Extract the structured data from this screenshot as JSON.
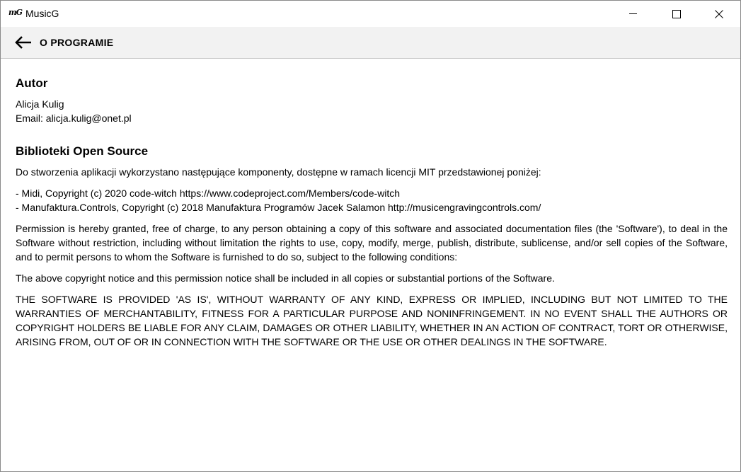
{
  "window": {
    "logo_text": "mG",
    "title": "MusicG"
  },
  "header": {
    "title": "O PROGRAMIE"
  },
  "author": {
    "heading": "Autor",
    "name": "Alicja Kulig",
    "email_line": "Email: alicja.kulig@onet.pl"
  },
  "open_source": {
    "heading": "Biblioteki Open Source",
    "intro": "Do stworzenia aplikacji wykorzystano następujące komponenty, dostępne w ramach licencji MIT przedstawionej poniżej:",
    "libraries": [
      "- Midi, Copyright (c) 2020 code-witch https://www.codeproject.com/Members/code-witch",
      "- Manufaktura.Controls, Copyright (c) 2018 Manufaktura Programów Jacek Salamon http://musicengravingcontrols.com/"
    ],
    "permission": "Permission is hereby granted, free of charge, to any person obtaining a copy of this software and associated documentation files (the 'Software'), to deal in the Software without restriction, including without limitation the rights to use, copy, modify, merge, publish, distribute, sublicense, and/or sell copies of the Software, and to permit persons to whom the Software is furnished to do so, subject to the following conditions:",
    "notice": "The above copyright notice and this permission notice shall be included in all copies or substantial portions of the Software.",
    "warranty": "THE SOFTWARE IS PROVIDED 'AS IS', WITHOUT WARRANTY OF ANY KIND, EXPRESS OR IMPLIED, INCLUDING BUT NOT LIMITED TO THE WARRANTIES OF MERCHANTABILITY, FITNESS FOR A PARTICULAR PURPOSE AND NONINFRINGEMENT. IN NO EVENT SHALL THE AUTHORS OR COPYRIGHT HOLDERS BE LIABLE FOR ANY CLAIM, DAMAGES OR OTHER LIABILITY, WHETHER IN AN ACTION OF CONTRACT, TORT OR OTHERWISE, ARISING FROM, OUT OF OR IN CONNECTION WITH THE SOFTWARE OR THE USE OR OTHER DEALINGS IN THE SOFTWARE."
  },
  "icons": {
    "back": "arrow-left-icon",
    "minimize": "minimize-icon",
    "maximize": "maximize-icon",
    "close": "close-icon"
  }
}
